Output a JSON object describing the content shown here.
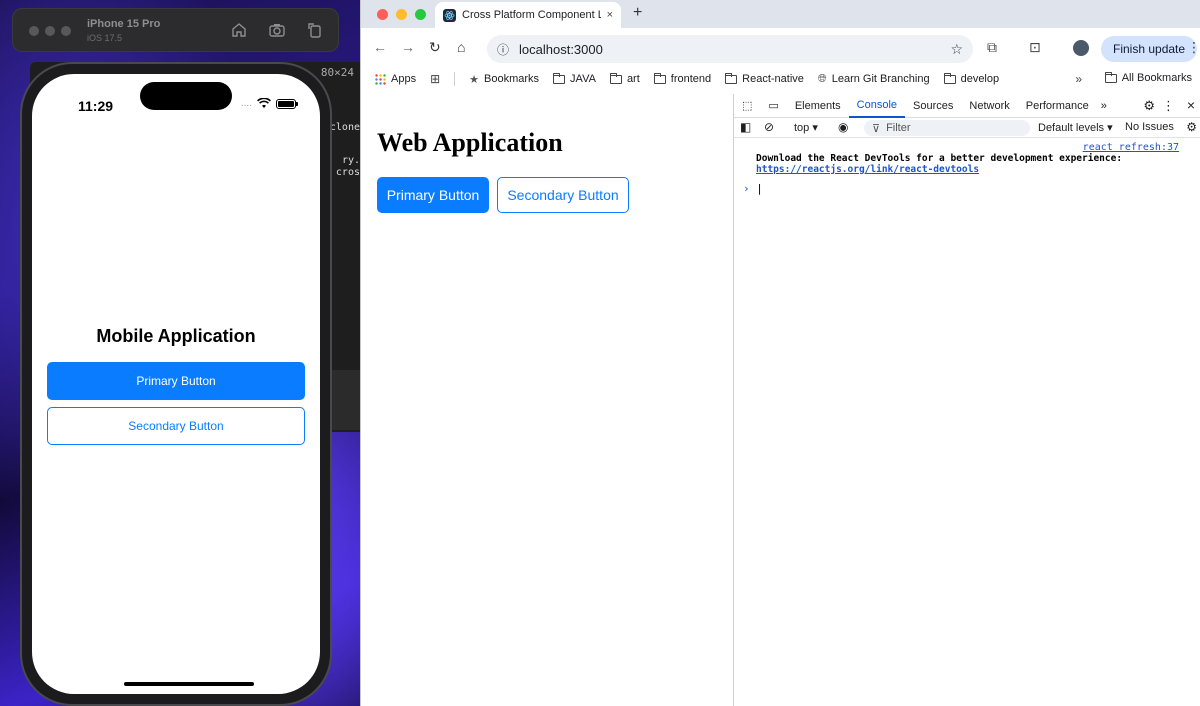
{
  "simulator": {
    "device_name": "iPhone 15 Pro",
    "os_version": "iOS 17.5",
    "terminal_size": "80×24",
    "terminal_lines": [
      "clone",
      "ry.",
      "cros"
    ]
  },
  "phone": {
    "time": "11:29",
    "signal": "....",
    "title": "Mobile Application",
    "primary_label": "Primary Button",
    "secondary_label": "Secondary Button"
  },
  "browser": {
    "tab_title": "Cross Platform Component Li",
    "tab_close": "×",
    "new_tab": "+",
    "url": "localhost:3000",
    "finish_update": "Finish update",
    "bookmarks": {
      "apps": "Apps",
      "items": [
        "Bookmarks",
        "JAVA",
        "art",
        "frontend",
        "React-native",
        "Learn Git Branching",
        "develop"
      ],
      "more": "»",
      "all": "All Bookmarks"
    }
  },
  "web_app": {
    "title": "Web Application",
    "primary_label": "Primary Button",
    "secondary_label": "Secondary Button"
  },
  "devtools": {
    "tabs": [
      "Elements",
      "Console",
      "Sources",
      "Network",
      "Performance"
    ],
    "active_tab": "Console",
    "more_tabs": "»",
    "context": "top",
    "filter_placeholder": "Filter",
    "levels": "Default levels",
    "issues": "No Issues",
    "source_link": "react refresh:37",
    "message": "Download the React DevTools for a better development experience:",
    "message_link": "https://reactjs.org/link/react-devtools",
    "prompt": "›"
  },
  "colors": {
    "accent": "#0a7cff",
    "devtools_active": "#0b57d0"
  }
}
